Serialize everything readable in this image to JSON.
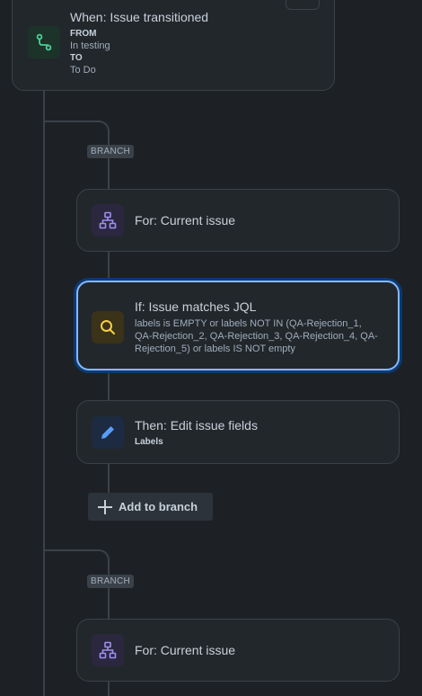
{
  "trigger": {
    "title": "When: Issue transitioned",
    "from_label": "FROM",
    "from_value": "In testing",
    "to_label": "TO",
    "to_value": "To Do"
  },
  "branch1": {
    "label": "BRANCH",
    "for_title": "For: Current issue",
    "condition_title": "If: Issue matches JQL",
    "condition_desc": "labels is EMPTY or labels NOT IN (QA-Rejection_1, QA-Rejection_2, QA-Rejection_3, QA-Rejection_4, QA-Rejection_5) or labels IS NOT empty",
    "action_title": "Then: Edit issue fields",
    "action_subtitle": "Labels",
    "add_label": "Add to branch"
  },
  "branch2": {
    "label": "BRANCH",
    "for_title": "For: Current issue"
  },
  "colors": {
    "background": "#1d2125",
    "card": "#22272b",
    "selected_border": "#85b8ff",
    "trigger_icon": "#4bce97",
    "branch_icon": "#9f8fef",
    "jql_icon": "#f5cd47",
    "edit_icon": "#579dff"
  },
  "icons": {
    "trigger": "transition-icon",
    "branch": "hierarchy-icon",
    "condition": "search-icon",
    "action": "pencil-icon",
    "add": "plus-icon"
  }
}
